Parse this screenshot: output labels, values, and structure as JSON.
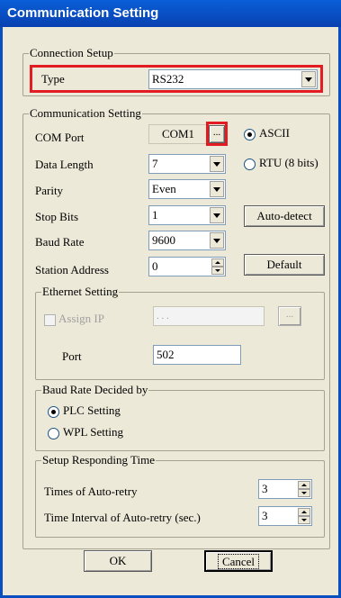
{
  "window": {
    "title": "Communication Setting"
  },
  "connection": {
    "legend": "Connection Setup",
    "type_label": "Type",
    "type_value": "RS232"
  },
  "comm": {
    "legend": "Communication Setting",
    "com_port_label": "COM Port",
    "com_port_value": "COM1",
    "browse_label": "...",
    "ascii_label": "ASCII",
    "rtu_label": "RTU (8 bits)",
    "data_length_label": "Data Length",
    "data_length_value": "7",
    "parity_label": "Parity",
    "parity_value": "Even",
    "stop_bits_label": "Stop Bits",
    "stop_bits_value": "1",
    "baud_rate_label": "Baud Rate",
    "baud_rate_value": "9600",
    "station_address_label": "Station Address",
    "station_address_value": "0",
    "auto_detect_label": "Auto-detect",
    "default_label": "Default"
  },
  "ethernet": {
    "legend": "Ethernet Setting",
    "assign_ip_label": "Assign IP",
    "ip_value": ". . .",
    "ip_browse_label": "...",
    "port_label": "Port",
    "port_value": "502"
  },
  "baud_decided": {
    "legend": "Baud Rate Decided by",
    "plc_label": "PLC Setting",
    "wpl_label": "WPL Setting"
  },
  "responding": {
    "legend": "Setup Responding Time",
    "retry_label": "Times of Auto-retry",
    "retry_value": "3",
    "interval_label": "Time Interval of Auto-retry (sec.)",
    "interval_value": "3"
  },
  "footer": {
    "ok_label": "OK",
    "cancel_label": "Cancel"
  },
  "colors": {
    "highlight": "#e31b23",
    "title_bar": "#0a5fd8"
  }
}
